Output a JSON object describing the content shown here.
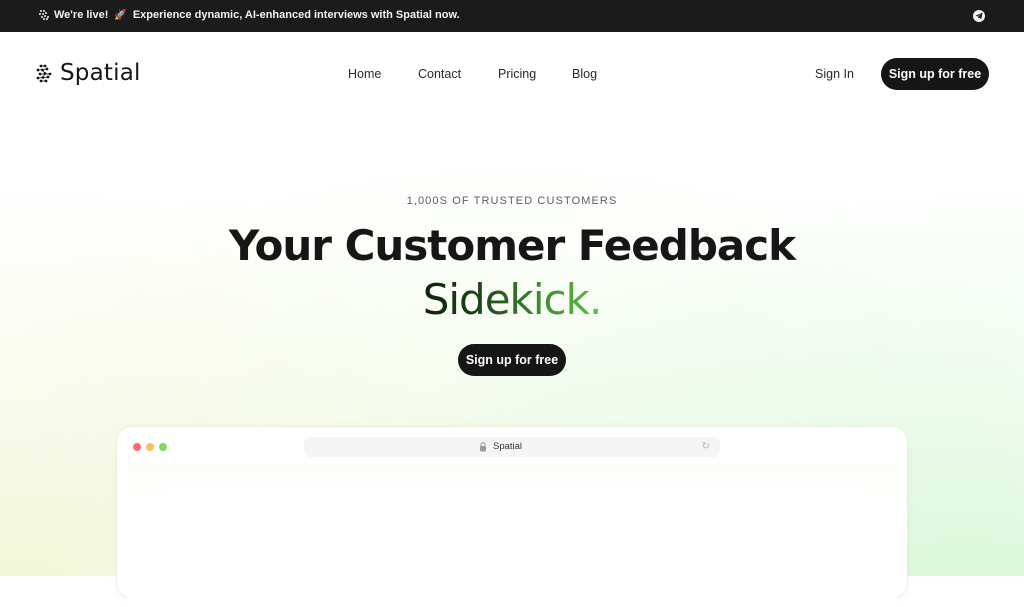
{
  "announcement": {
    "live_label": "We're live!",
    "rocket_icon": "🚀",
    "message": "Experience dynamic, AI-enhanced interviews with Spatial now.",
    "social_icon": "telegram-icon"
  },
  "brand": {
    "name": "Spatial"
  },
  "nav": {
    "links": [
      {
        "label": "Home"
      },
      {
        "label": "Contact"
      },
      {
        "label": "Pricing"
      },
      {
        "label": "Blog"
      }
    ],
    "sign_in": "Sign In",
    "cta": "Sign up for free"
  },
  "hero": {
    "eyebrow": "1,000S OF TRUSTED CUSTOMERS",
    "headline_line1": "Your Customer Feedback",
    "headline_line2": "Sidekick.",
    "cta": "Sign up for free"
  },
  "browser_mock": {
    "address_text": "Spatial",
    "traffic_lights": [
      "#ff6b6b",
      "#ffbd5c",
      "#7ddc5a"
    ]
  },
  "colors": {
    "announcement_bg": "#1b1b1c",
    "button_dark": "#161616",
    "accent_green": "#5fc245"
  }
}
